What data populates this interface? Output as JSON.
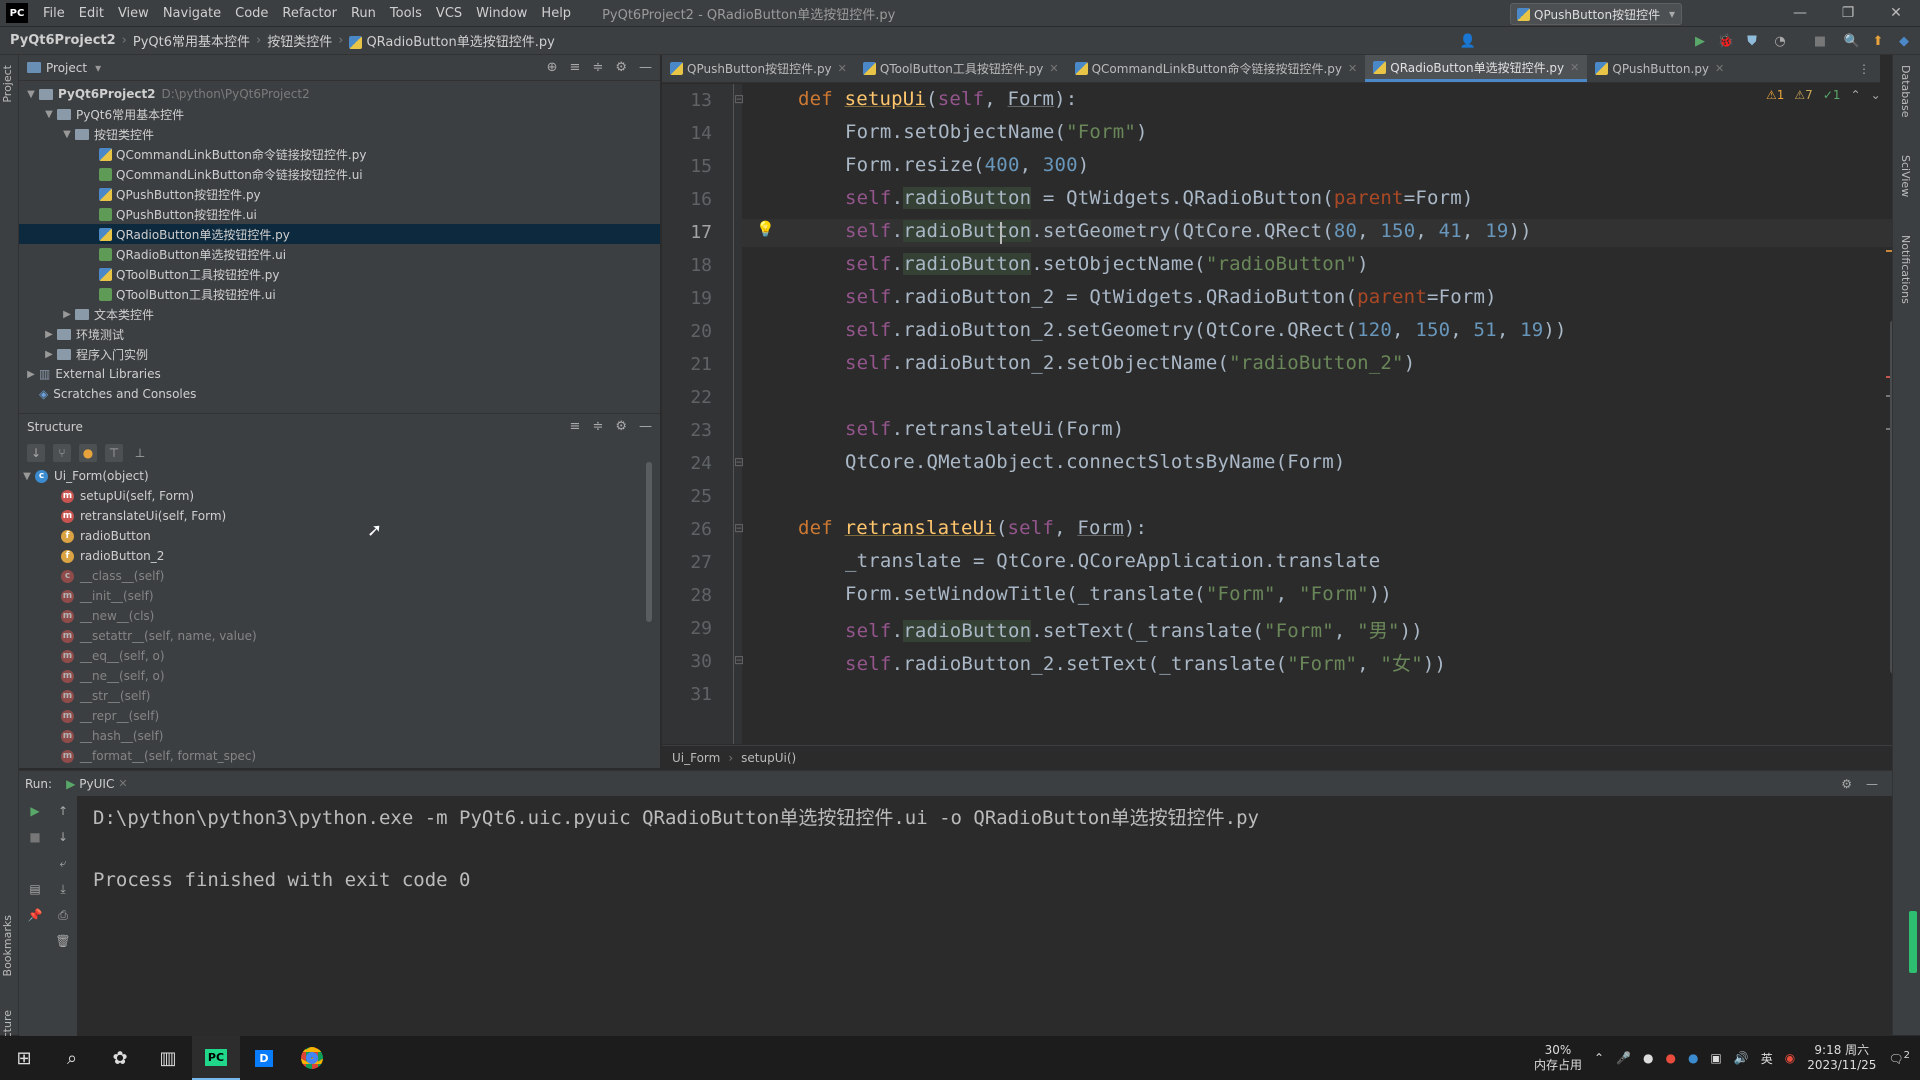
{
  "menubar": {
    "logo": "PC",
    "items": [
      "File",
      "Edit",
      "View",
      "Navigate",
      "Code",
      "Refactor",
      "Run",
      "Tools",
      "VCS",
      "Window",
      "Help"
    ],
    "window_title": "PyQt6Project2 - QRadioButton单选按钮控件.py"
  },
  "navbar": {
    "crumbs": [
      "PyQt6Project2",
      "PyQt6常用基本控件",
      "按钮类控件",
      "QRadioButton单选按钮控件.py"
    ],
    "run_config": "QPushButton按钮控件"
  },
  "sidebar_tabs": {
    "project": "Project",
    "bookmarks": "Bookmarks",
    "structure": "Structure"
  },
  "right_tabs": {
    "database": "Database",
    "sciview": "SciView",
    "notifications": "Notifications"
  },
  "project": {
    "header": "Project",
    "root": "PyQt6Project2",
    "root_path": "D:\\python\\PyQt6Project2",
    "folder1": "PyQt6常用基本控件",
    "folder2": "按钮类控件",
    "files": [
      "QCommandLinkButton命令链接按钮控件.py",
      "QCommandLinkButton命令链接按钮控件.ui",
      "QPushButton按钮控件.py",
      "QPushButton按钮控件.ui",
      "QRadioButton单选按钮控件.py",
      "QRadioButton单选按钮控件.ui",
      "QToolButton工具按钮控件.py",
      "QToolButton工具按钮控件.ui"
    ],
    "folder3": "文本类控件",
    "folder4": "环境测试",
    "folder5": "程序入门实例",
    "external": "External Libraries",
    "scratches": "Scratches and Consoles"
  },
  "structure": {
    "header": "Structure",
    "root": "Ui_Form(object)",
    "members": [
      {
        "label": "setupUi(self, Form)",
        "kind": "m",
        "dim": false
      },
      {
        "label": "retranslateUi(self, Form)",
        "kind": "m",
        "dim": false
      },
      {
        "label": "radioButton",
        "kind": "f",
        "dim": false
      },
      {
        "label": "radioButton_2",
        "kind": "f",
        "dim": false
      },
      {
        "label": "__class__(self)",
        "kind": "c",
        "dim": true
      },
      {
        "label": "__init__(self)",
        "kind": "m",
        "dim": true
      },
      {
        "label": "__new__(cls)",
        "kind": "m",
        "dim": true
      },
      {
        "label": "__setattr__(self, name, value)",
        "kind": "m",
        "dim": true
      },
      {
        "label": "__eq__(self, o)",
        "kind": "m",
        "dim": true
      },
      {
        "label": "__ne__(self, o)",
        "kind": "m",
        "dim": true
      },
      {
        "label": "__str__(self)",
        "kind": "m",
        "dim": true
      },
      {
        "label": "__repr__(self)",
        "kind": "m",
        "dim": true
      },
      {
        "label": "__hash__(self)",
        "kind": "m",
        "dim": true
      },
      {
        "label": "__format__(self, format_spec)",
        "kind": "m",
        "dim": true
      }
    ]
  },
  "tabs": [
    {
      "label": "QPushButton按钮控件.py",
      "active": false
    },
    {
      "label": "QToolButton工具按钮控件.py",
      "active": false
    },
    {
      "label": "QCommandLinkButton命令链接按钮控件.py",
      "active": false
    },
    {
      "label": "QRadioButton单选按钮控件.py",
      "active": true
    },
    {
      "label": "QPushButton.py",
      "active": false
    }
  ],
  "editor": {
    "inspections": {
      "warnings": "1",
      "weak": "7",
      "ok": "1"
    },
    "current_line": 17,
    "lines": [
      {
        "n": "13"
      },
      {
        "n": "14"
      },
      {
        "n": "15"
      },
      {
        "n": "16"
      },
      {
        "n": "17"
      },
      {
        "n": "18"
      },
      {
        "n": "19"
      },
      {
        "n": "20"
      },
      {
        "n": "21"
      },
      {
        "n": "22"
      },
      {
        "n": "23"
      },
      {
        "n": "24"
      },
      {
        "n": "25"
      },
      {
        "n": "26"
      },
      {
        "n": "27"
      },
      {
        "n": "28"
      },
      {
        "n": "29"
      },
      {
        "n": "30"
      },
      {
        "n": "31"
      }
    ],
    "code": {
      "l13": {
        "kw": "def ",
        "fn": "setupUi",
        "rest": "(",
        "self": "self",
        "mid": ", ",
        "p": "Form",
        "end": "):"
      },
      "l14": {
        "a": "Form.setObjectName(",
        "s": "\"Form\"",
        "b": ")"
      },
      "l15": {
        "a": "Form.resize(",
        "n1": "400",
        "c": ", ",
        "n2": "300",
        "b": ")"
      },
      "l16": {
        "self": "self",
        "dot": ".",
        "attr": "radioButton",
        "a": " = QtWidgets.QRadioButton(",
        "kwarg": "parent",
        "b": "=Form)"
      },
      "l17": {
        "self": "self",
        "dot": ".",
        "attr": "radioButton",
        "a": ".setGeometry(QtCore.QRect(",
        "n1": "80",
        "n2": "150",
        "n3": "41",
        "n4": "19",
        "b": "))"
      },
      "l18": {
        "self": "self",
        "dot": ".",
        "attr": "radioButton",
        "a": ".setObjectName(",
        "s": "\"radioButton\"",
        "b": ")"
      },
      "l19": {
        "self": "self",
        "a": ".radioButton_2 = QtWidgets.QRadioButton(",
        "kwarg": "parent",
        "b": "=Form)"
      },
      "l20": {
        "self": "self",
        "a": ".radioButton_2.setGeometry(QtCore.QRect(",
        "n1": "120",
        "n2": "150",
        "n3": "51",
        "n4": "19",
        "b": "))"
      },
      "l21": {
        "self": "self",
        "a": ".radioButton_2.setObjectName(",
        "s": "\"radioButton_2\"",
        "b": ")"
      },
      "l23": {
        "self": "self",
        "a": ".retranslateUi(Form)"
      },
      "l24": {
        "a": "QtCore.QMetaObject.connectSlotsByName(Form)"
      },
      "l26": {
        "kw": "def ",
        "fn": "retranslateUi",
        "rest": "(",
        "self": "self",
        "mid": ", ",
        "p": "Form",
        "end": "):"
      },
      "l27": {
        "a": "_translate = QtCore.QCoreApplication.translate"
      },
      "l28": {
        "a": "Form.setWindowTitle(_translate(",
        "s1": "\"Form\"",
        "c": ", ",
        "s2": "\"Form\"",
        "b": "))"
      },
      "l29": {
        "self": "self",
        "dot": ".",
        "attr": "radioButton",
        "a": ".setText(_translate(",
        "s1": "\"Form\"",
        "c": ", ",
        "s2": "\"男\"",
        "b": "))"
      },
      "l30": {
        "self": "self",
        "a": ".radioButton_2.setText(_translate(",
        "s1": "\"Form\"",
        "c": ", ",
        "s2": "\"女\"",
        "b": "))"
      }
    },
    "breadcrumb": [
      "Ui_Form",
      "setupUi()"
    ]
  },
  "run": {
    "label": "Run:",
    "tab": "PyUIC",
    "command": "D:\\python\\python3\\python.exe -m PyQt6.uic.pyuic QRadioButton单选按钮控件.ui -o QRadioButton单选按钮控件.py",
    "result": "Process finished with exit code 0"
  },
  "taskbar": {
    "mem_percent": "30%",
    "mem_label": "内存占用",
    "ime": "英",
    "time": "9:18 周六",
    "date": "2023/11/25",
    "notif_count": "2"
  },
  "colors": {
    "keyword": "#cc7832",
    "function": "#ffc66d",
    "self": "#94558d",
    "string": "#6a8759",
    "number": "#6897bb",
    "accent": "#4a88c7"
  }
}
